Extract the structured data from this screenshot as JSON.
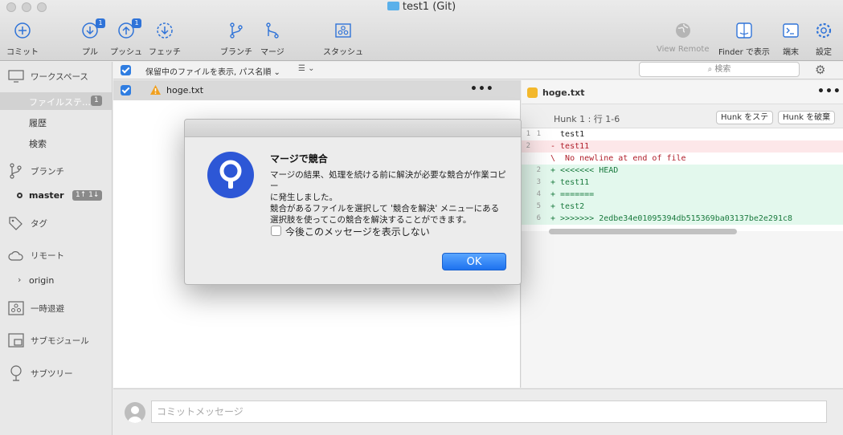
{
  "window": {
    "title": "test1 (Git)"
  },
  "toolbar": {
    "commit": "コミット",
    "pull": "プル",
    "pull_badge": "1",
    "push": "プッシュ",
    "push_badge": "1",
    "fetch": "フェッチ",
    "branch": "ブランチ",
    "merge": "マージ",
    "stash": "スタッシュ",
    "view_remote": "View Remote",
    "finder": "Finder で表示",
    "terminal": "端末",
    "settings": "設定"
  },
  "sidebar": {
    "workspace": "ワークスペース",
    "file_status": "ファイルステ…",
    "file_status_count": "1",
    "history": "履歴",
    "search": "検索",
    "branches": "ブランチ",
    "current_branch": "master",
    "branch_status": "1↑ 1↓",
    "tags": "タグ",
    "remotes": "リモート",
    "remote_origin": "origin",
    "stashes": "一時退避",
    "submodules": "サブモジュール",
    "subtrees": "サブツリー"
  },
  "filter": {
    "mode": "保留中のファイルを表示, パス名順",
    "search_placeholder": "検索"
  },
  "files": [
    {
      "name": "hoge.txt",
      "status": "conflict",
      "checked": true
    }
  ],
  "diff": {
    "file": "hoge.txt",
    "hunk_title": "Hunk 1 : 行 1-6",
    "stage_btn": "Hunk をステ",
    "discard_btn": "Hunk を破棄",
    "lines": [
      {
        "old": "1",
        "new": "1",
        "type": "ctx",
        "text": "  test1"
      },
      {
        "old": "2",
        "new": "",
        "type": "del",
        "text": "- test11"
      },
      {
        "old": "",
        "new": "",
        "type": "note",
        "text": "\\  No newline at end of file"
      },
      {
        "old": "",
        "new": "2",
        "type": "add",
        "text": "+ <<<<<<< HEAD"
      },
      {
        "old": "",
        "new": "3",
        "type": "add",
        "text": "+ test11"
      },
      {
        "old": "",
        "new": "4",
        "type": "add",
        "text": "+ ======="
      },
      {
        "old": "",
        "new": "5",
        "type": "add",
        "text": "+ test2"
      },
      {
        "old": "",
        "new": "6",
        "type": "add",
        "text": "+ >>>>>>> 2edbe34e01095394db515369ba03137be2e291c8"
      }
    ]
  },
  "commit": {
    "placeholder": "コミットメッセージ"
  },
  "dialog": {
    "title": "マージで競合",
    "message_line1": "マージの結果、処理を続ける前に解決が必要な競合が作業コピー",
    "message_line2": "に発生しました。",
    "message_line3": "競合があるファイルを選択して '競合を解決' メニューにある",
    "message_line4": "選択肢を使ってこの競合を解決することができます。",
    "dont_show": "今後このメッセージを表示しない",
    "ok": "OK"
  },
  "colors": {
    "accent": "#2f7de1",
    "add": "#1a7a3e",
    "del": "#b01e2a"
  }
}
